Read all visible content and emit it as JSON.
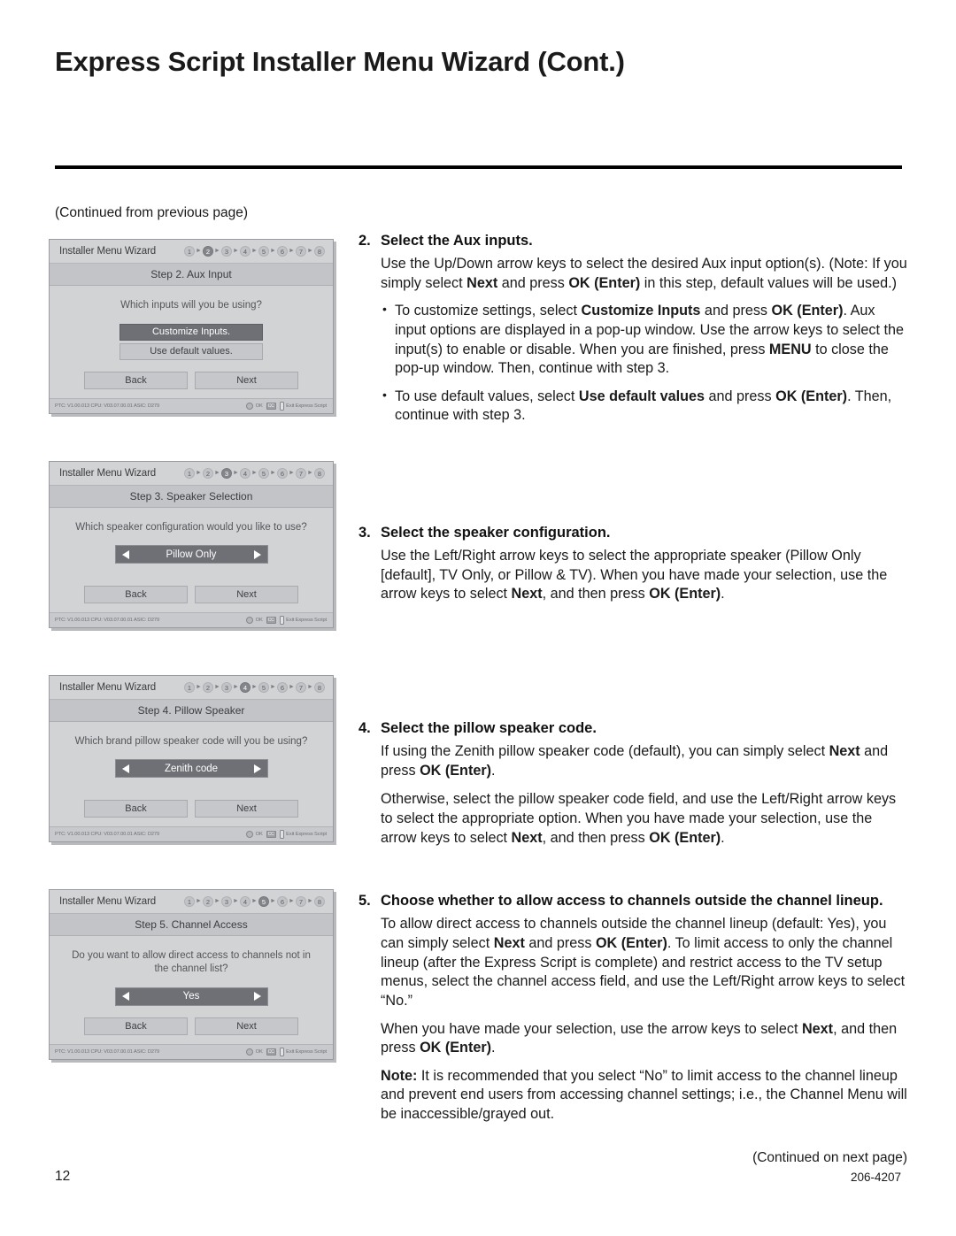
{
  "page": {
    "title": "Express Script Installer Menu Wizard (Cont.)",
    "continued_from": "(Continued from previous page)",
    "continued_next": "(Continued on next page)",
    "page_number": "12",
    "document_number": "206-4207"
  },
  "panels": [
    {
      "window_title": "Installer Menu Wizard",
      "steps": [
        "1",
        "2",
        "3",
        "4",
        "5",
        "6",
        "7",
        "8"
      ],
      "active_step": "2",
      "step_title": "Step 2. Aux Input",
      "question": "Which inputs will you be using?",
      "control_type": "options",
      "options": [
        {
          "label": "Customize Inputs.",
          "selected": true
        },
        {
          "label": "Use default values.",
          "selected": false
        }
      ],
      "back_label": "Back",
      "next_label": "Next",
      "footer_version": "PTC: V1.00.013 CPU: V03.07.00.01 ASIC: D279",
      "footer_ok": "OK",
      "footer_cc": "CC",
      "footer_exit": "Exit Express Script"
    },
    {
      "window_title": "Installer Menu Wizard",
      "steps": [
        "1",
        "2",
        "3",
        "4",
        "5",
        "6",
        "7",
        "8"
      ],
      "active_step": "3",
      "step_title": "Step 3. Speaker Selection",
      "question": "Which speaker configuration would you like to use?",
      "control_type": "spinner",
      "spinner_value": "Pillow Only",
      "back_label": "Back",
      "next_label": "Next",
      "footer_version": "PTC: V1.00.013 CPU: V03.07.00.01 ASIC: D279",
      "footer_ok": "OK",
      "footer_cc": "CC",
      "footer_exit": "Exit Express Script"
    },
    {
      "window_title": "Installer Menu Wizard",
      "steps": [
        "1",
        "2",
        "3",
        "4",
        "5",
        "6",
        "7",
        "8"
      ],
      "active_step": "4",
      "step_title": "Step 4. Pillow Speaker",
      "question": "Which brand pillow speaker code will you be using?",
      "control_type": "spinner",
      "spinner_value": "Zenith code",
      "back_label": "Back",
      "next_label": "Next",
      "footer_version": "PTC: V1.00.013 CPU: V03.07.00.01 ASIC: D279",
      "footer_ok": "OK",
      "footer_cc": "CC",
      "footer_exit": "Exit Express Script"
    },
    {
      "window_title": "Installer Menu Wizard",
      "steps": [
        "1",
        "2",
        "3",
        "4",
        "5",
        "6",
        "7",
        "8"
      ],
      "active_step": "5",
      "step_title": "Step 5. Channel Access",
      "question": "Do you want to allow direct access to channels not in the channel list?",
      "control_type": "spinner",
      "spinner_value": "Yes",
      "back_label": "Back",
      "next_label": "Next",
      "footer_version": "PTC: V1.00.013 CPU: V03.07.00.01 ASIC: D279",
      "footer_ok": "OK",
      "footer_cc": "CC",
      "footer_exit": "Exit Express Script"
    }
  ],
  "items": [
    {
      "number": "2.",
      "heading": "Select the Aux inputs.",
      "paragraph_html": "Use the Up/Down arrow keys to select the desired Aux input option(s). (Note: If you simply select <b>Next</b> and press <b>OK (Enter)</b> in this step, default values will be used.)",
      "bullets_html": [
        "To customize settings, select <b>Customize Inputs</b> and press <b>OK (Enter)</b>. Aux input options are displayed in a pop-up window. Use the arrow keys to select the input(s) to enable or disable. When you are finished, press <b>MENU</b> to close the pop-up window. Then, continue with step 3.",
        "To use default values, select <b>Use default values</b> and press <b>OK (Enter)</b>. Then, continue with step 3."
      ]
    },
    {
      "number": "3.",
      "heading": "Select the speaker configuration.",
      "paragraph_html": "Use the Left/Right arrow keys to select the appropriate speaker (Pillow Only [default], TV Only, or Pillow &amp; TV). When you have made your selection, use the arrow keys to select <b>Next</b>, and then press <b>OK (Enter)</b>."
    },
    {
      "number": "4.",
      "heading": "Select the pillow speaker code.",
      "paragraph_html": "If using the Zenith pillow speaker code (default), you can simply select <b>Next</b> and press <b>OK (Enter)</b>.",
      "paragraph2_html": "Otherwise, select the pillow speaker code field, and use the Left/Right arrow keys to select the appropriate option. When you have made your selection, use the arrow keys to select <b>Next</b>, and then press <b>OK (Enter)</b>."
    },
    {
      "number": "5.",
      "heading": "Choose whether to allow access to channels outside the channel lineup.",
      "paragraph_html": "To allow direct access to channels outside the channel lineup (default: Yes), you can simply select <b>Next</b> and press <b>OK (Enter)</b>. To limit access to only the channel lineup (after the Express Script is complete) and restrict access to the TV setup menus, select the channel access field, and use the Left/Right arrow keys to select “No.”",
      "paragraph2_html": "When you have made your selection, use the arrow keys to select <b>Next</b>, and then press <b>OK (Enter)</b>.",
      "paragraph3_html": "<b>Note:</b> It is recommended that you select “No” to limit access to the channel lineup and prevent end users from accessing channel settings; i.e., the Channel Menu will be inaccessible/grayed out."
    }
  ]
}
